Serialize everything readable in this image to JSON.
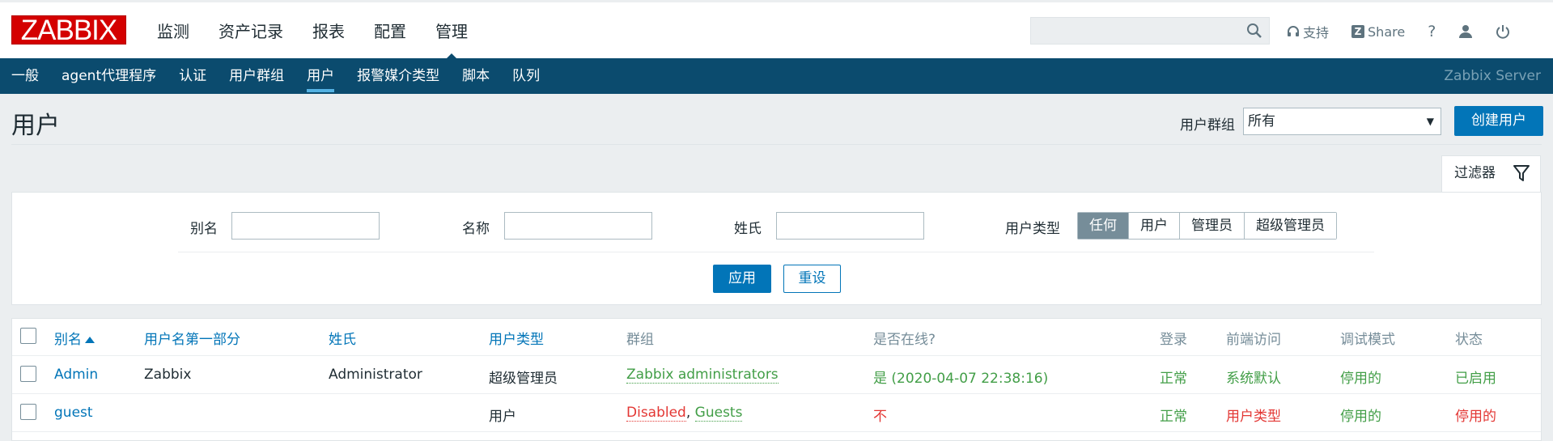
{
  "logo": "ZABBIX",
  "main_nav": [
    "监测",
    "资产记录",
    "报表",
    "配置",
    "管理"
  ],
  "top_right": {
    "support": "支持",
    "share": "Share",
    "help": "?"
  },
  "sub_nav": [
    "一般",
    "agent代理程序",
    "认证",
    "用户群组",
    "用户",
    "报警媒介类型",
    "脚本",
    "队列"
  ],
  "server_name": "Zabbix Server",
  "page": {
    "title": "用户",
    "group_label": "用户群组",
    "group_value": "所有",
    "create_button": "创建用户"
  },
  "filter": {
    "tab_label": "过滤器",
    "alias_label": "别名",
    "name_label": "名称",
    "surname_label": "姓氏",
    "type_label": "用户类型",
    "type_options": [
      "任何",
      "用户",
      "管理员",
      "超级管理员"
    ],
    "type_selected": "任何",
    "apply": "应用",
    "reset": "重设"
  },
  "table": {
    "headers": [
      "别名",
      "用户名第一部分",
      "姓氏",
      "用户类型",
      "群组",
      "是否在线?",
      "登录",
      "前端访问",
      "调试模式",
      "状态"
    ],
    "rows": [
      {
        "alias": "Admin",
        "name": "Zabbix",
        "surname": "Administrator",
        "type": "超级管理员",
        "groups": [
          "Zabbix administrators"
        ],
        "sep": "",
        "online": "是 (2020-04-07 22:38:16)",
        "login": "正常",
        "frontend": "系统默认",
        "debug": "停用的",
        "status": "已启用"
      },
      {
        "alias": "guest",
        "name": "",
        "surname": "",
        "type": "用户",
        "groups": [
          "Disabled",
          "Guests"
        ],
        "sep": ", ",
        "online": "不",
        "login": "正常",
        "frontend": "用户类型",
        "debug": "停用的",
        "status": "停用的"
      }
    ]
  },
  "colors": {
    "accent": "#0275b8",
    "nav_bg": "#0b4b6e",
    "green": "#429e47",
    "red": "#e33734",
    "logo": "#d40000"
  }
}
